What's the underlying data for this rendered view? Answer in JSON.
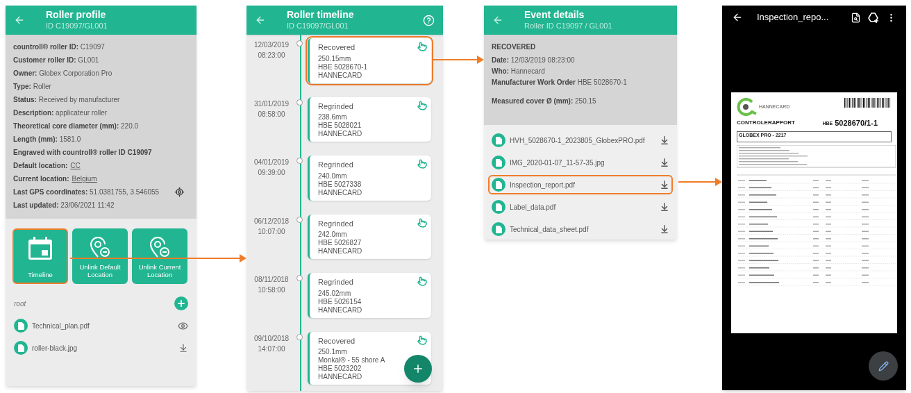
{
  "roller_profile": {
    "title": "Roller profile",
    "subtitle": "ID C19097/GL001",
    "fields": [
      {
        "kind": "text",
        "label": "countroll® roller ID:",
        "value": "C19097"
      },
      {
        "kind": "text",
        "label": "Customer roller ID:",
        "value": "GL001"
      },
      {
        "kind": "text",
        "label": "Owner:",
        "value": "Globex Corporation Pro"
      },
      {
        "kind": "text",
        "label": "Type:",
        "value": "Roller"
      },
      {
        "kind": "text",
        "label": "Status:",
        "value": "Received by manufacturer"
      },
      {
        "kind": "text",
        "label": "Description:",
        "value": "applicateur roller"
      },
      {
        "kind": "text",
        "label": "Theoretical core diameter (mm):",
        "value": "220.0"
      },
      {
        "kind": "text",
        "label": "Length (mm):",
        "value": "1581.0"
      },
      {
        "kind": "text",
        "label": "Engraved with countroll® roller ID C19097"
      },
      {
        "kind": "link",
        "label": "Default location:",
        "value": "CC"
      },
      {
        "kind": "link",
        "label": "Current location:",
        "value": "Belgium"
      },
      {
        "kind": "gps",
        "label": "Last GPS coordinates:",
        "value": "51.0381755, 3.546055"
      },
      {
        "kind": "text",
        "label": "Last updated:",
        "value": "23/06/2021 11:42"
      }
    ],
    "actions": [
      {
        "kind": "calendar",
        "label": "Timeline",
        "highlighted": true
      },
      {
        "kind": "unlink",
        "label": "Unlink Default Location",
        "highlighted": false
      },
      {
        "kind": "unlink",
        "label": "Unlink Current Location",
        "highlighted": false
      }
    ],
    "folder": "root",
    "files": [
      {
        "name": "Technical_plan.pdf",
        "kind": "view"
      },
      {
        "name": "roller-black.jpg",
        "kind": "download"
      }
    ]
  },
  "roller_timeline": {
    "title": "Roller timeline",
    "subtitle": "ID C19097/GL001",
    "events": [
      {
        "date": "12/03/2019",
        "time": "08:23:00",
        "type": "Recovered",
        "lines": [
          "250.15mm",
          "HBE 5028670-1",
          "HANNECARD"
        ],
        "highlighted": true
      },
      {
        "date": "31/01/2019",
        "time": "08:58:00",
        "type": "Regrinded",
        "lines": [
          "238.6mm",
          "HBE 5028021",
          "HANNECARD"
        ],
        "highlighted": false
      },
      {
        "date": "04/01/2019",
        "time": "09:39:00",
        "type": "Regrinded",
        "lines": [
          "240.0mm",
          "HBE 5027338",
          "HANNECARD"
        ],
        "highlighted": false
      },
      {
        "date": "06/12/2018",
        "time": "10:07:00",
        "type": "Regrinded",
        "lines": [
          "242.0mm",
          "HBE 5026827",
          "HANNECARD"
        ],
        "highlighted": false
      },
      {
        "date": "08/11/2018",
        "time": "10:58:00",
        "type": "Regrinded",
        "lines": [
          "245.02mm",
          "HBE 5026154",
          "HANNECARD"
        ],
        "highlighted": false
      },
      {
        "date": "09/10/2018",
        "time": "14:07:00",
        "type": "Recovered",
        "lines": [
          "250.1mm",
          "Monkal® - 55 shore A",
          "HBE 5023202",
          "HANNECARD"
        ],
        "highlighted": false
      }
    ]
  },
  "event_details": {
    "title": "Event details",
    "subtitle": "Roller ID C19097 / GL001",
    "event_type": "RECOVERED",
    "fields": [
      {
        "label": "Date:",
        "value": "12/03/2019 08:23:00"
      },
      {
        "label": "Who:",
        "value": "Hannecard"
      },
      {
        "label": "Manufacturer Work Order",
        "value": "HBE 5028670-1"
      }
    ],
    "measurement": {
      "label": "Measured cover Ø (mm):",
      "value": "250.15"
    },
    "files": [
      {
        "name": "HVH_5028670-1_2023805_GlobexPRO.pdf",
        "highlighted": false
      },
      {
        "name": "IMG_2020-01-07_11-57-35.jpg",
        "highlighted": false
      },
      {
        "name": "Inspection_report.pdf",
        "highlighted": true
      },
      {
        "name": "Label_data.pdf",
        "highlighted": false
      },
      {
        "name": "Technical_data_sheet.pdf",
        "highlighted": false
      }
    ]
  },
  "document_viewer": {
    "title": "Inspection_repo...",
    "document": {
      "logo": "HANNECARD",
      "heading": "CONTROLERAPPORT",
      "prefix": "HBE",
      "number": "5028670/1-1",
      "customer": "GLOBEX PRO - 2217"
    }
  }
}
